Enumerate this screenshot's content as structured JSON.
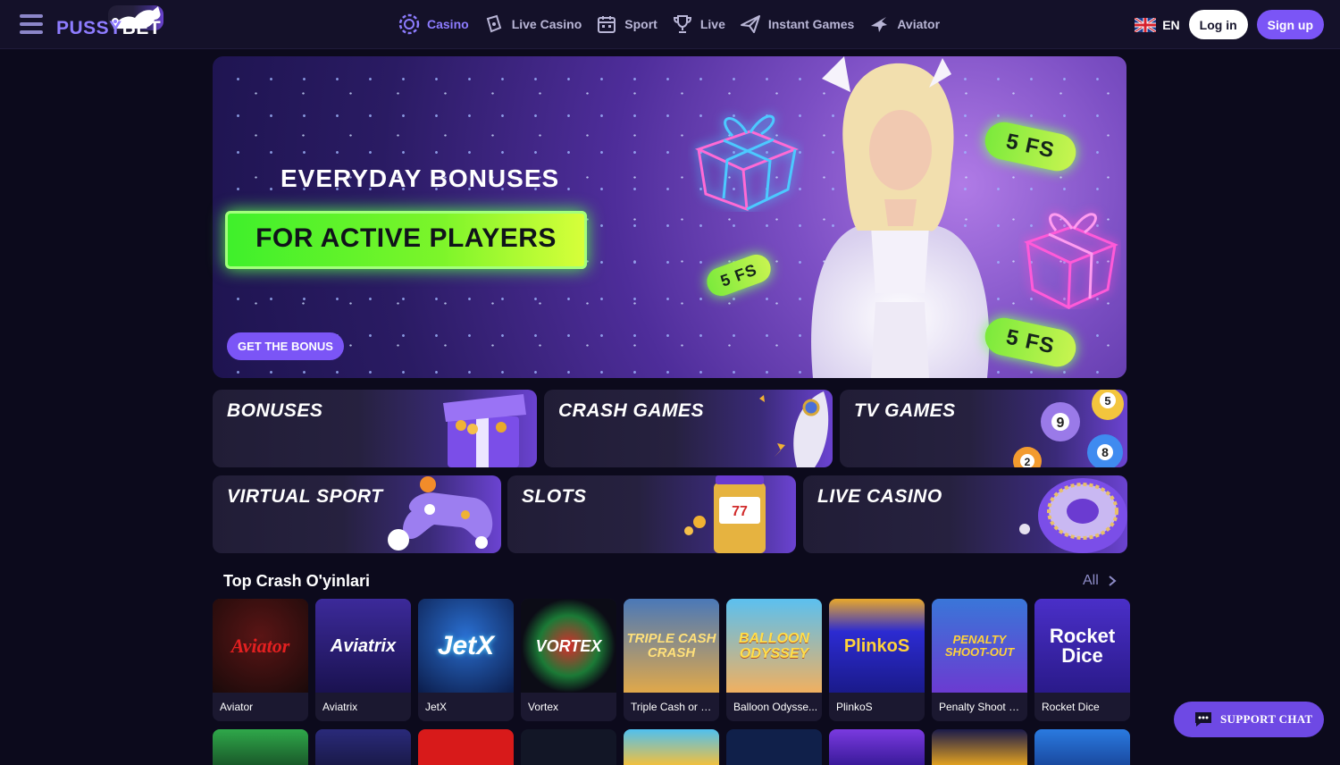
{
  "header": {
    "logo_text_a": "PUSSY",
    "logo_text_b": "BET",
    "nav": [
      {
        "label": "Casino",
        "icon": "casino-chip-icon",
        "active": true
      },
      {
        "label": "Live Casino",
        "icon": "live-casino-icon"
      },
      {
        "label": "Sport",
        "icon": "calendar-sport-icon"
      },
      {
        "label": "Live",
        "icon": "trophy-icon"
      },
      {
        "label": "Instant Games",
        "icon": "plane-icon"
      },
      {
        "label": "Aviator",
        "icon": "aviator-plane-icon"
      }
    ],
    "lang": "EN",
    "login_label": "Log in",
    "signup_label": "Sign up"
  },
  "hero": {
    "headline": "EVERYDAY BONUSES",
    "highlight": "FOR ACTIVE PLAYERS",
    "cta": "GET THE BONUS",
    "fs_badges": [
      "5 FS",
      "5 FS",
      "5 FS"
    ]
  },
  "categories": [
    {
      "label": "BONUSES"
    },
    {
      "label": "CRASH GAMES"
    },
    {
      "label": "TV GAMES"
    },
    {
      "label": "VIRTUAL SPORT"
    },
    {
      "label": "SLOTS"
    },
    {
      "label": "LIVE CASINO"
    }
  ],
  "section": {
    "title": "Top Crash O'yinlari",
    "all_label": "All"
  },
  "games": [
    {
      "name": "Aviator",
      "art": "Aviator"
    },
    {
      "name": "Aviatrix",
      "art": "Aviatrix"
    },
    {
      "name": "JetX",
      "art": "JetX"
    },
    {
      "name": "Vortex",
      "art": "VORTEX"
    },
    {
      "name": "Triple Cash or C...",
      "art": "TRIPLE CASH CRASH"
    },
    {
      "name": "Balloon Odysse...",
      "art": "BALLOON ODYSSEY"
    },
    {
      "name": "PlinkoS",
      "art": "PlinkoS"
    },
    {
      "name": "Penalty Shoot Out",
      "art": "PENALTY SHOOT-OUT"
    },
    {
      "name": "Rocket Dice",
      "art": "Rocket Dice"
    }
  ],
  "support_label": "SUPPORT CHAT",
  "colors": {
    "accent": "#7b55f6",
    "active_nav": "#8d7cff",
    "green": "#57f34a"
  }
}
